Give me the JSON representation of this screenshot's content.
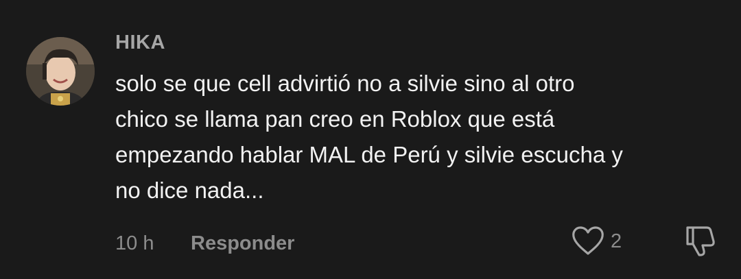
{
  "comment": {
    "username": "HIKA",
    "text_lines": [
      "solo se que cell advirtió no a silvie sino al otro",
      "chico se llama pan creo en Roblox que está",
      "empezando hablar MAL de Perú y silvie escucha y",
      "no dice nada..."
    ],
    "timestamp": "10 h",
    "reply_label": "Responder",
    "like_count": "2",
    "icons": {
      "like": "heart-icon",
      "dislike": "thumbs-down-icon"
    }
  },
  "colors": {
    "background": "#1a1a1a",
    "username": "#a6a6a6",
    "text": "#f2f2f2",
    "meta": "#8c8c8c"
  }
}
